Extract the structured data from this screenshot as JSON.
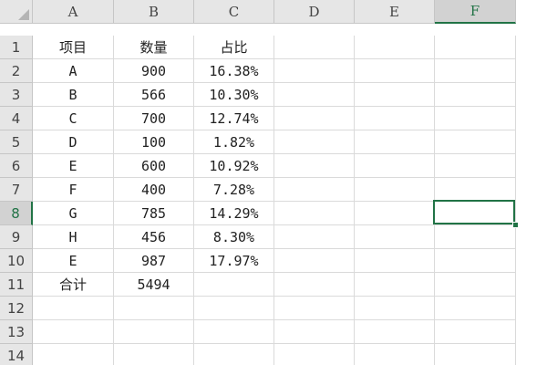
{
  "columns": [
    "A",
    "B",
    "C",
    "D",
    "E",
    "F"
  ],
  "rows": [
    "1",
    "2",
    "3",
    "4",
    "5",
    "6",
    "7",
    "8",
    "9",
    "10",
    "11",
    "12",
    "13",
    "14"
  ],
  "active_cell": {
    "column": "F",
    "row": "8"
  },
  "cells": [
    [
      "项目",
      "数量",
      "占比",
      "",
      "",
      ""
    ],
    [
      "A",
      "900",
      "16.38%",
      "",
      "",
      ""
    ],
    [
      "B",
      "566",
      "10.30%",
      "",
      "",
      ""
    ],
    [
      "C",
      "700",
      "12.74%",
      "",
      "",
      ""
    ],
    [
      "D",
      "100",
      "1.82%",
      "",
      "",
      ""
    ],
    [
      "E",
      "600",
      "10.92%",
      "",
      "",
      ""
    ],
    [
      "F",
      "400",
      "7.28%",
      "",
      "",
      ""
    ],
    [
      "G",
      "785",
      "14.29%",
      "",
      "",
      ""
    ],
    [
      "H",
      "456",
      "8.30%",
      "",
      "",
      ""
    ],
    [
      "E",
      "987",
      "17.97%",
      "",
      "",
      ""
    ],
    [
      "合计",
      "5494",
      "",
      "",
      "",
      ""
    ],
    [
      "",
      "",
      "",
      "",
      "",
      ""
    ],
    [
      "",
      "",
      "",
      "",
      "",
      ""
    ],
    [
      "",
      "",
      "",
      "",
      "",
      ""
    ]
  ],
  "colors": {
    "accent": "#217346",
    "header_bg": "#e6e6e6",
    "gridline": "#dadada"
  }
}
